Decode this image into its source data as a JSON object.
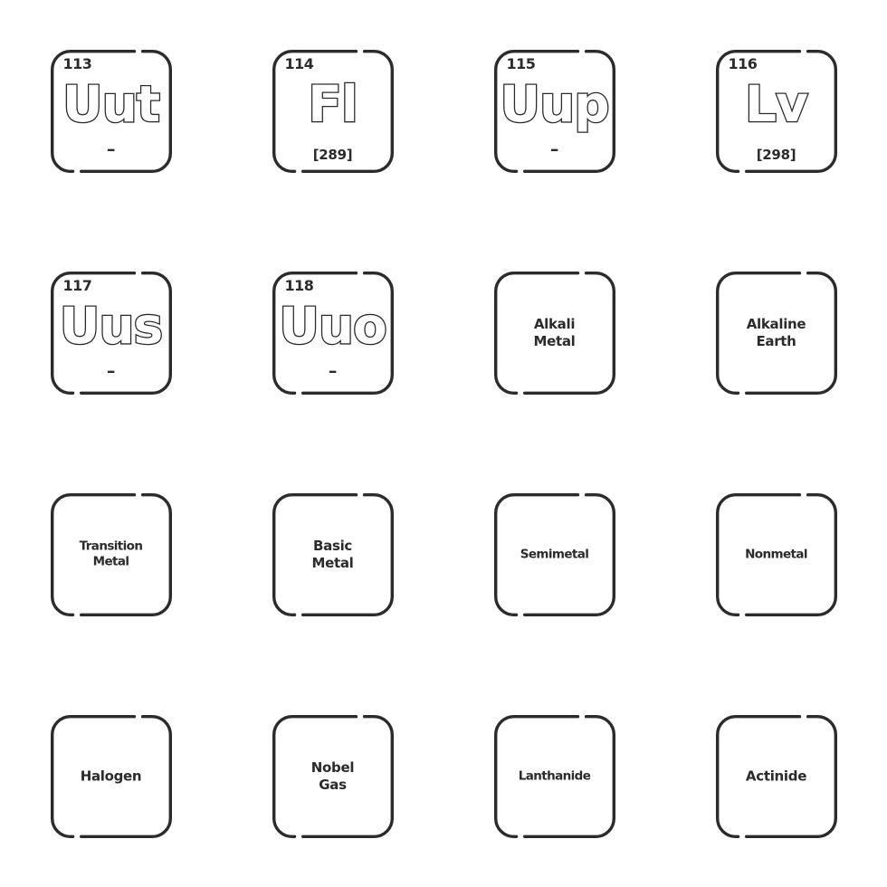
{
  "sheet": {
    "title": "Periodic Table Elements and Categories Icon Set",
    "background_color": "#ffffff",
    "stroke_color": "#2b2b2b",
    "columns": 4,
    "rows": 4
  },
  "icons": [
    {
      "kind": "element",
      "name": "element-113-uut",
      "atomic_number": "113",
      "symbol": "Uut",
      "atomic_mass": "–",
      "mass_known": false,
      "symbol_style": "sym-wide"
    },
    {
      "kind": "element",
      "name": "element-114-fl",
      "atomic_number": "114",
      "symbol": "Fl",
      "atomic_mass": "[289]",
      "mass_known": true,
      "symbol_style": "sym-wide"
    },
    {
      "kind": "element",
      "name": "element-115-uup",
      "atomic_number": "115",
      "symbol": "Uup",
      "atomic_mass": "–",
      "mass_known": false,
      "symbol_style": "sym-wide"
    },
    {
      "kind": "element",
      "name": "element-116-lv",
      "atomic_number": "116",
      "symbol": "Lv",
      "atomic_mass": "[298]",
      "mass_known": true,
      "symbol_style": "sym-wide"
    },
    {
      "kind": "element",
      "name": "element-117-uus",
      "atomic_number": "117",
      "symbol": "Uus",
      "atomic_mass": "–",
      "mass_known": false,
      "symbol_style": "sym-wide"
    },
    {
      "kind": "element",
      "name": "element-118-uuo",
      "atomic_number": "118",
      "symbol": "Uuo",
      "atomic_mass": "–",
      "mass_known": false,
      "symbol_style": "sym-wide"
    },
    {
      "kind": "category",
      "name": "category-alkali-metal",
      "label": "Alkali\nMetal",
      "label_style": ""
    },
    {
      "kind": "category",
      "name": "category-alkaline-earth",
      "label": "Alkaline\nEarth",
      "label_style": ""
    },
    {
      "kind": "category",
      "name": "category-transition-metal",
      "label": "Transition\nMetal",
      "label_style": "cat-long"
    },
    {
      "kind": "category",
      "name": "category-basic-metal",
      "label": "Basic\nMetal",
      "label_style": ""
    },
    {
      "kind": "category",
      "name": "category-semimetal",
      "label": "Semimetal",
      "label_style": "cat-long"
    },
    {
      "kind": "category",
      "name": "category-nonmetal",
      "label": "Nonmetal",
      "label_style": "cat-long"
    },
    {
      "kind": "category",
      "name": "category-halogen",
      "label": "Halogen",
      "label_style": ""
    },
    {
      "kind": "category",
      "name": "category-nobel-gas",
      "label": "Nobel\nGas",
      "label_style": ""
    },
    {
      "kind": "category",
      "name": "category-lanthanide",
      "label": "Lanthanide",
      "label_style": "cat-long"
    },
    {
      "kind": "category",
      "name": "category-actinide",
      "label": "Actinide",
      "label_style": ""
    }
  ]
}
